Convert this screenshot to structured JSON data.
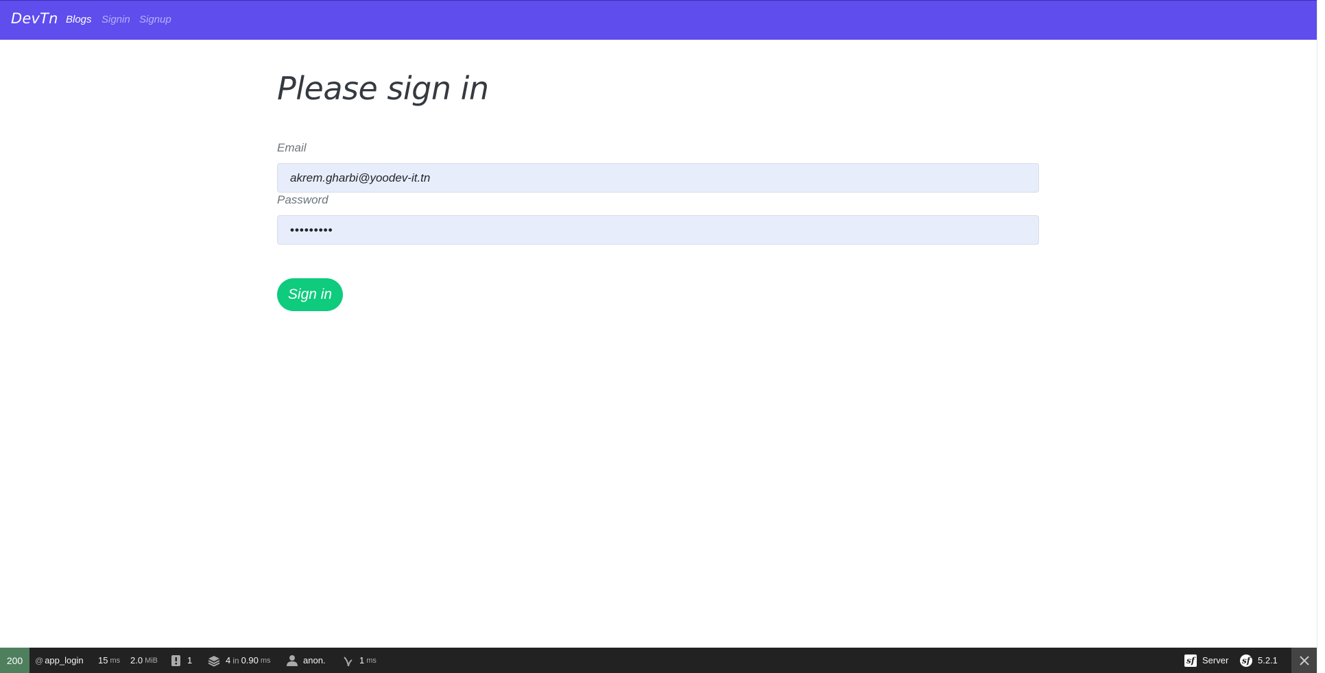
{
  "navbar": {
    "brand": "DevTn",
    "links": [
      "Blogs",
      "Signin",
      "Signup"
    ]
  },
  "form": {
    "title": "Please sign in",
    "email_label": "Email",
    "email_value": "akrem.gharbi@yoodev-it.tn",
    "password_label": "Password",
    "password_value": "•••••••••",
    "submit_label": "Sign in"
  },
  "toolbar": {
    "status_code": "200",
    "route_prefix": "@",
    "route": "app_login",
    "time_value": "15",
    "time_unit": "ms",
    "memory_value": "2.0",
    "memory_unit": "MiB",
    "logs_count": "1",
    "db_queries": "4",
    "db_in": "in",
    "db_time": "0.90",
    "db_unit": "ms",
    "user": "anon.",
    "twig_time": "1",
    "twig_unit": "ms",
    "server_label": "Server",
    "symfony_version": "5.2.1"
  },
  "colors": {
    "navbar_bg": "#5f4ded",
    "button_bg": "#0ecb7d",
    "input_bg": "#e8edfb",
    "status_bg": "#4f805d",
    "toolbar_bg": "#222222"
  }
}
